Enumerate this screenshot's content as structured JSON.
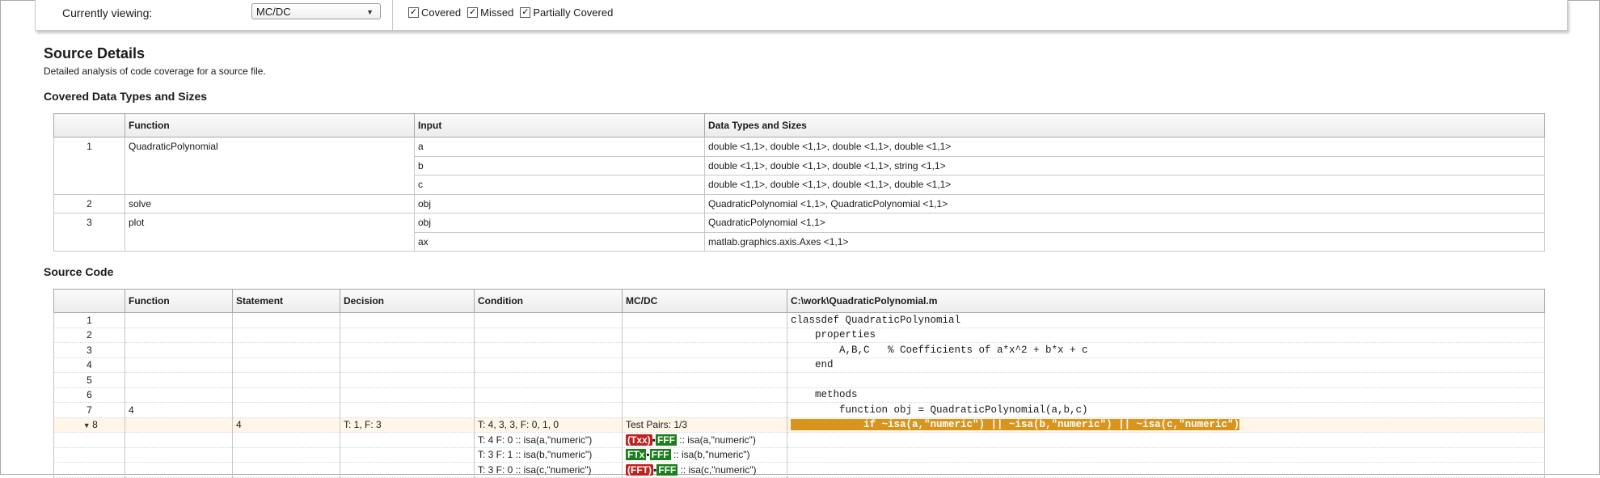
{
  "filter": {
    "viewing_label": "Currently viewing:",
    "viewing_value": "MC/DC",
    "checks": [
      {
        "label": "Covered",
        "checked": true
      },
      {
        "label": "Missed",
        "checked": true
      },
      {
        "label": "Partially Covered",
        "checked": true
      }
    ]
  },
  "title": "Source Details",
  "subtitle": "Detailed analysis of code coverage for a source file.",
  "types_heading": "Covered Data Types and Sizes",
  "types_table": {
    "headers": [
      "",
      "Function",
      "Input",
      "Data Types and Sizes"
    ],
    "rows": [
      {
        "num": "1",
        "func": "QuadraticPolynomial",
        "input": "a",
        "types": "double <1,1>, double <1,1>, double <1,1>, double <1,1>"
      },
      {
        "num": "",
        "func": "",
        "input": "b",
        "types": "double <1,1>, double <1,1>, double <1,1>, string <1,1>"
      },
      {
        "num": "",
        "func": "",
        "input": "c",
        "types": "double <1,1>, double <1,1>, double <1,1>, double <1,1>"
      },
      {
        "num": "2",
        "func": "solve",
        "input": "obj",
        "types": "QuadraticPolynomial <1,1>, QuadraticPolynomial <1,1>"
      },
      {
        "num": "3",
        "func": "plot",
        "input": "obj",
        "types": "QuadraticPolynomial <1,1>"
      },
      {
        "num": "",
        "func": "",
        "input": "ax",
        "types": "matlab.graphics.axis.Axes <1,1>"
      }
    ]
  },
  "source_heading": "Source Code",
  "source_table": {
    "headers": [
      "",
      "Function",
      "Statement",
      "Decision",
      "Condition",
      "MC/DC",
      "C:\\work\\QuadraticPolynomial.m"
    ],
    "rows": [
      {
        "line": "1",
        "func": "",
        "stmt": "",
        "dec": "",
        "cond": "",
        "code": "classdef QuadraticPolynomial"
      },
      {
        "line": "2",
        "func": "",
        "stmt": "",
        "dec": "",
        "cond": "",
        "code": "    properties"
      },
      {
        "line": "3",
        "func": "",
        "stmt": "",
        "dec": "",
        "cond": "",
        "code": "        A,B,C   % Coefficients of a*x^2 + b*x + c"
      },
      {
        "line": "4",
        "func": "",
        "stmt": "",
        "dec": "",
        "cond": "",
        "code": "    end"
      },
      {
        "line": "5",
        "func": "",
        "stmt": "",
        "dec": "",
        "cond": "",
        "code": ""
      },
      {
        "line": "6",
        "func": "",
        "stmt": "",
        "dec": "",
        "cond": "",
        "code": "    methods"
      },
      {
        "line": "7",
        "func": "4",
        "stmt": "",
        "dec": "",
        "cond": "",
        "code": "        function obj = QuadraticPolynomial(a,b,c)"
      },
      {
        "line": "8",
        "func": "",
        "stmt": "4",
        "dec": "T: 1, F: 3",
        "cond": "T: 4, 3, 3, F: 0, 1, 0",
        "mcdc": "Test Pairs: 1/3",
        "code": "            if ~isa(a,\"numeric\") || ~isa(b,\"numeric\") || ~isa(c,\"numeric\")"
      }
    ],
    "sub_rows": [
      {
        "cond": "T: 4 F: 0 :: isa(a,\"numeric\")",
        "badge1": "(Txx)",
        "badge2": "FFF",
        "mcdc_rest": " :: isa(a,\"numeric\")"
      },
      {
        "cond": "T: 3 F: 1 :: isa(b,\"numeric\")",
        "badge1": "FTx",
        "badge2": "FFF",
        "mcdc_rest": " :: isa(b,\"numeric\")"
      },
      {
        "cond": "T: 3 F: 0 :: isa(c,\"numeric\")",
        "badge1": "(FFT)",
        "badge2": "FFF",
        "mcdc_rest": " :: isa(c,\"numeric\")"
      }
    ]
  },
  "colors": {
    "highlight": "#d9941e",
    "badge_red": "#c0211d",
    "badge_green": "#1b7d1b"
  }
}
